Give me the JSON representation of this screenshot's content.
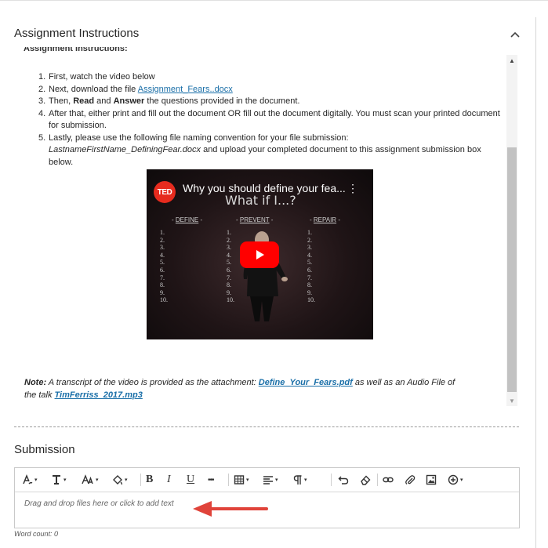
{
  "colors": {
    "link": "#1a6fa8",
    "ted_red": "#e62b1e",
    "annotation_arrow": "#e0433a"
  },
  "assignment": {
    "title": "Assignment Instructions",
    "clipped_heading": "Assignment Instructions:",
    "steps": [
      {
        "num": "1.",
        "text": "First, watch the video below"
      },
      {
        "num": "2.",
        "prefix": "Next, download the file ",
        "link": "Assignment_Fears..docx"
      },
      {
        "num": "3.",
        "p1": "Then, ",
        "b1": "Read",
        "p2": " and ",
        "b2": "Answer",
        "p3": " the questions provided in the document."
      },
      {
        "num": "4.",
        "text": "After that, either print and fill out the document OR fill out the document digitally. You must scan your printed document for submission."
      },
      {
        "num": "5.",
        "prefix": "Lastly, please use the following file naming convention for your file submission: ",
        "italic": "LastnameFirstName_DefiningFear.docx",
        "suffix": " and upload your completed document to this assignment submission box below."
      }
    ],
    "video": {
      "logo": "TED",
      "title": "Why you should define your fea...",
      "subhead": "What if I...?",
      "columns": [
        {
          "head": "DEFINE",
          "nums": [
            "1.",
            "2.",
            "3.",
            "4.",
            "5.",
            "6.",
            "7.",
            "8.",
            "9.",
            "10."
          ]
        },
        {
          "head": "PREVENT",
          "nums": [
            "1.",
            "2.",
            "3.",
            "4.",
            "5.",
            "6.",
            "7.",
            "8.",
            "9.",
            "10."
          ]
        },
        {
          "head": "REPAIR",
          "nums": [
            "1.",
            "2.",
            "3.",
            "4.",
            "5.",
            "6.",
            "7.",
            "8.",
            "9.",
            "10."
          ]
        }
      ]
    },
    "note": {
      "label": "Note:",
      "text1": " A transcript of the video is provided as the attachment: ",
      "link1": "Define_Your_Fears.pdf",
      "text2": " as well as an Audio File of the talk ",
      "link2": "TimFerriss_2017.mp3"
    }
  },
  "submission": {
    "title": "Submission",
    "placeholder": "Drag and drop files here or click to add text",
    "word_count": "Word count: 0"
  },
  "toolbar": {
    "icons": [
      "text-style-icon",
      "font-icon",
      "font-size-icon",
      "highlight-icon",
      "bold-icon",
      "italic-icon",
      "underline-icon",
      "more-icon",
      "table-icon",
      "align-icon",
      "paragraph-icon",
      "undo-icon",
      "clear-format-icon",
      "link-icon",
      "attach-icon",
      "image-icon",
      "insert-content-icon"
    ],
    "bold": "B",
    "italic": "I",
    "underline": "U",
    "more": "•••"
  }
}
